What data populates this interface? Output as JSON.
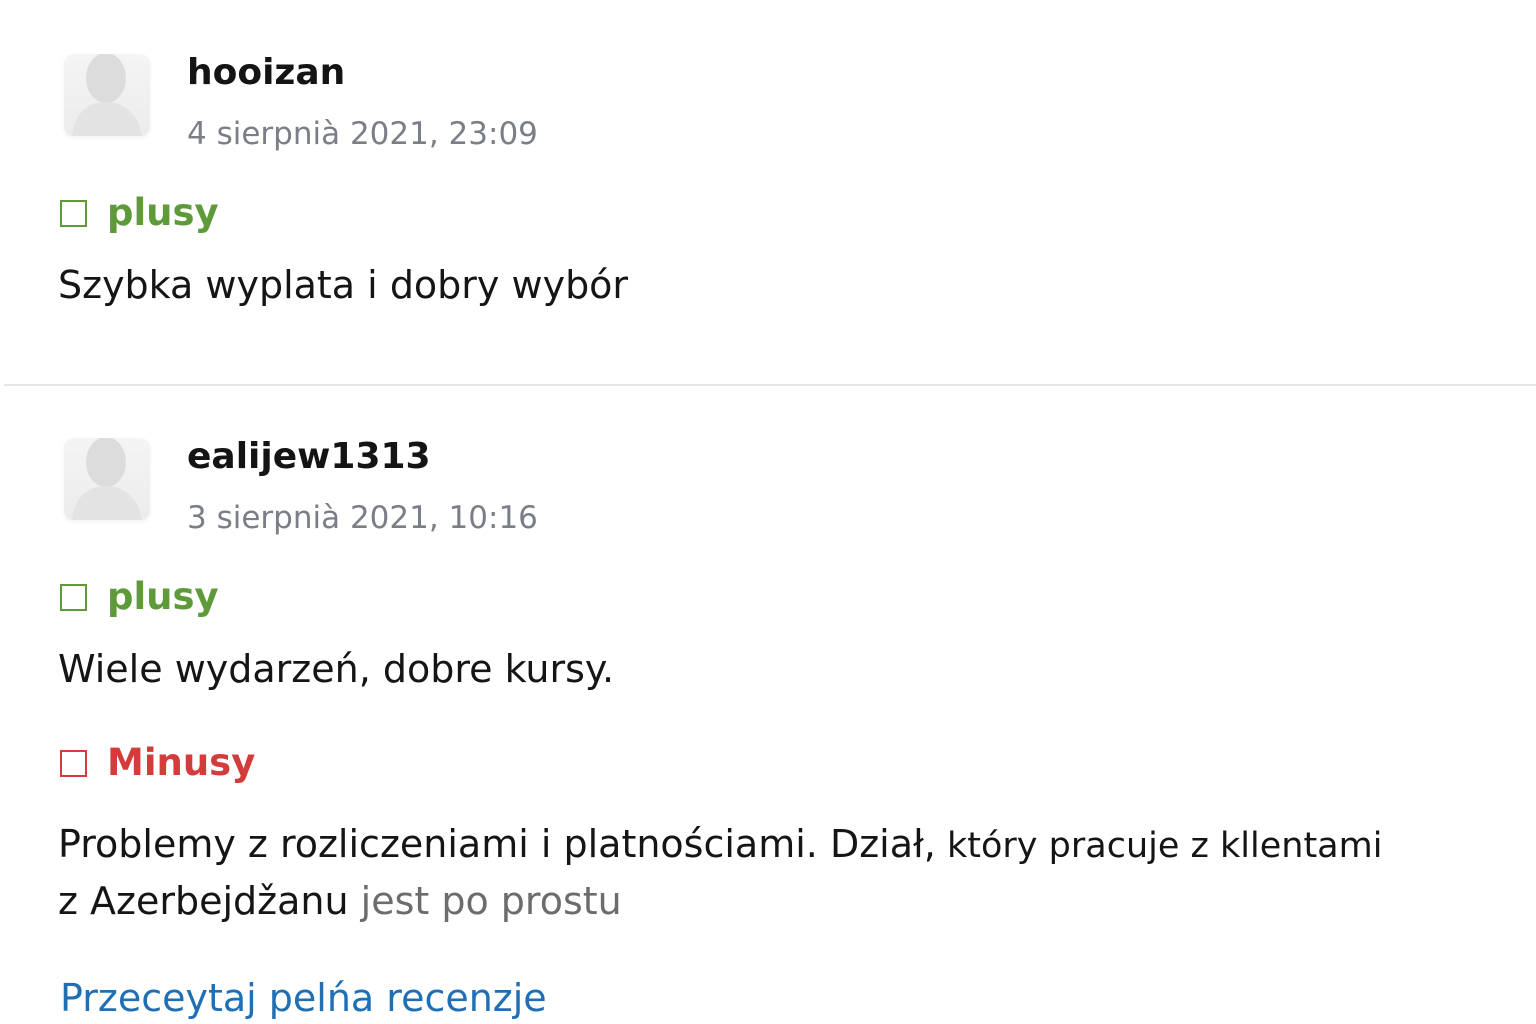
{
  "reviews": [
    {
      "username": "hooizan",
      "date": "4 sierpnià 2021, 23:09",
      "pros_label": "plusy",
      "pros_text": "Szybka wyplata i dobry wybór"
    },
    {
      "username": "ealijew1313",
      "date": "3 sierpnià 2021, 10:16",
      "pros_label": "plusy",
      "pros_text": "Wiele wydarzeń, dobre kursy.",
      "cons_label": "Minusy",
      "cons_line1_a": "Problemy z rozliczeniami i platnościami. Dział,",
      "cons_line1_b": " który pracuje z kllentami",
      "cons_line2_a": "z Azerbejdžanu",
      "cons_line2_b": " jest po prostu"
    }
  ],
  "read_more_label": "Przeceytaj pelńa recenzje",
  "icons": {
    "avatar": "user-silhouette-icon",
    "pros": "checkbox-icon",
    "cons": "checkbox-icon"
  },
  "colors": {
    "pros": "#5f9a3a",
    "cons": "#d43c3c",
    "link": "#1f6fb5",
    "date": "#7a7f87"
  }
}
